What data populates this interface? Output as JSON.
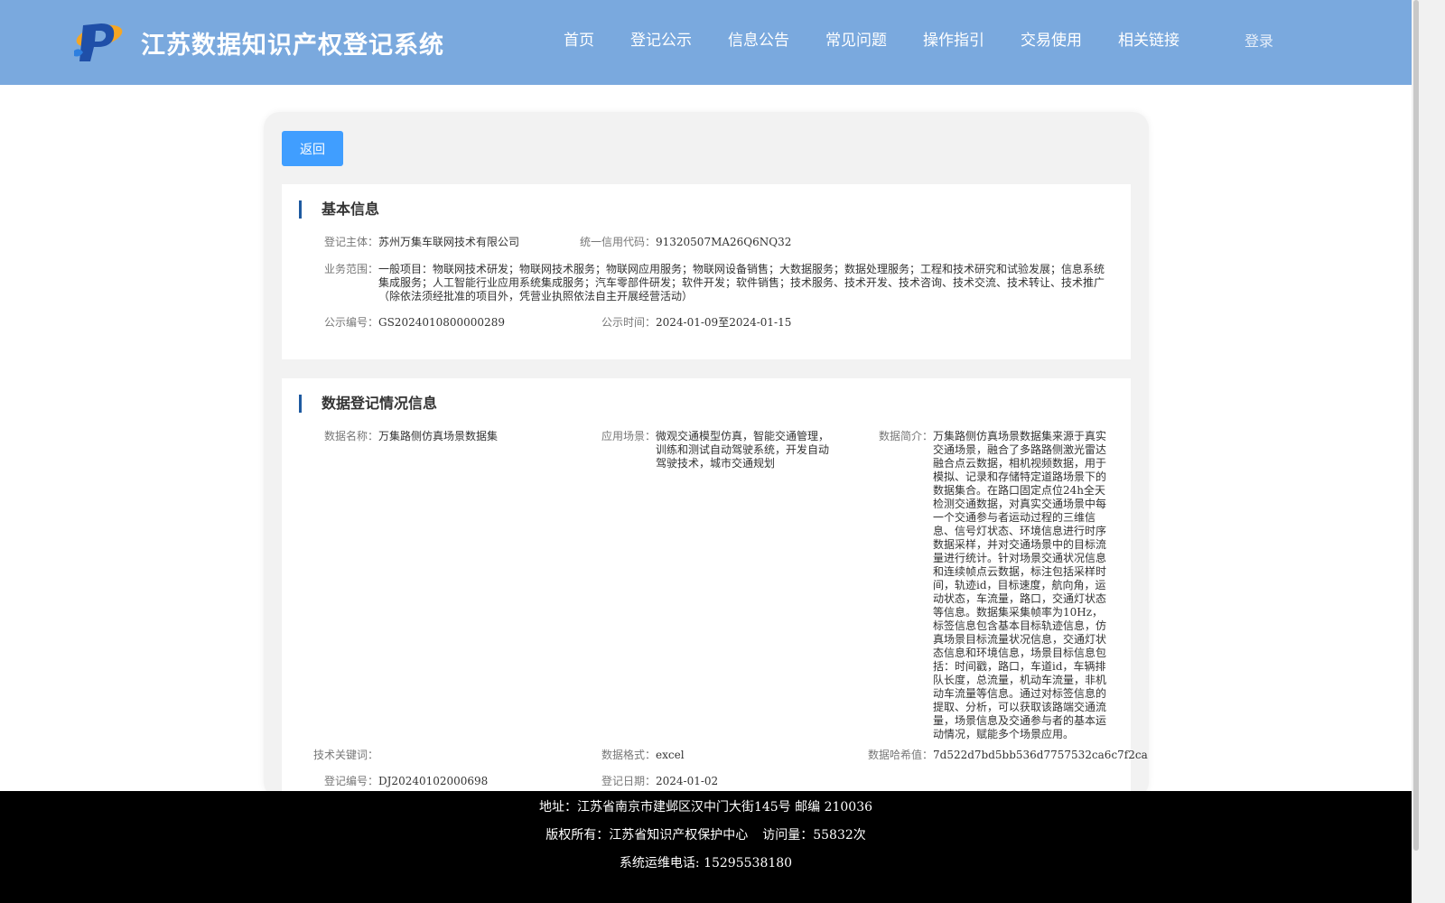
{
  "header": {
    "site_title": "江苏数据知识产权登记系统",
    "nav": [
      "首页",
      "登记公示",
      "信息公告",
      "常见问题",
      "操作指引",
      "交易使用",
      "相关链接"
    ],
    "login": "登录"
  },
  "back_label": "返回",
  "basic_info": {
    "title": "基本信息",
    "registrant_label": "登记主体：",
    "registrant": "苏州万集车联网技术有限公司",
    "credit_code_label": "统一信用代码：",
    "credit_code": "91320507MA26Q6NQ32",
    "business_scope_label": "业务范围：",
    "business_scope": "一般项目：物联网技术研发；物联网技术服务；物联网应用服务；物联网设备销售；大数据服务；数据处理服务；工程和技术研究和试验发展；信息系统集成服务；人工智能行业应用系统集成服务；汽车零部件研发；软件开发；软件销售；技术服务、技术开发、技术咨询、技术交流、技术转让、技术推广（除依法须经批准的项目外，凭营业执照依法自主开展经营活动）",
    "notice_no_label": "公示编号：",
    "notice_no": "GS2024010800000289",
    "notice_time_label": "公示时间：",
    "notice_time": "2024-01-09至2024-01-15"
  },
  "data_info": {
    "title": "数据登记情况信息",
    "data_name_label": "数据名称：",
    "data_name": "万集路侧仿真场景数据集",
    "scenario_label": "应用场景：",
    "scenario": "微观交通模型仿真，智能交通管理，训练和测试自动驾驶系统，开发自动驾驶技术，城市交通规划",
    "intro_label": "数据简介：",
    "intro": "万集路侧仿真场景数据集来源于真实交通场景，融合了多路路侧激光雷达融合点云数据，相机视频数据，用于模拟、记录和存储特定道路场景下的数据集合。在路口固定点位24h全天检测交通数据，对真实交通场景中每一个交通参与者运动过程的三维信息、信号灯状态、环境信息进行时序数据采样，并对交通场景中的目标流量进行统计。针对场景交通状况信息和连续帧点云数据，标注包括采样时间，轨迹id，目标速度，航向角，运动状态，车流量，路口，交通灯状态等信息。数据集采集帧率为10Hz，标签信息包含基本目标轨迹信息，仿真场景目标流量状况信息，交通灯状态信息和环境信息，场景目标信息包括：时间戳，路口，车道id，车辆排队长度，总流量，机动车流量，非机动车流量等信息。通过对标签信息的提取、分析，可以获取该路端交通流量，场景信息及交通参与者的基本运动情况，赋能多个场景应用。",
    "keywords_label": "技术关键词：",
    "keywords": "",
    "format_label": "数据格式：",
    "format": "excel",
    "hash_label": "数据哈希值：",
    "hash": "7d522d7bd5bb536d7757532ca6c7f2ca",
    "reg_no_label": "登记编号：",
    "reg_no": "DJ20240102000698",
    "reg_date_label": "登记日期：",
    "reg_date": "2024-01-02"
  },
  "footer": {
    "address": "地址：江苏省南京市建邺区汉中门大街145号 邮编 210036",
    "copyright": "版权所有：江苏省知识产权保护中心",
    "visits": "访问量：55832次",
    "phone": "系统运维电话: 15295538180"
  },
  "colors": {
    "header_bg": "#7aa9de",
    "button_bg": "#409eff",
    "accent_bar": "#1e5aa0",
    "footer_bg": "#000000"
  }
}
